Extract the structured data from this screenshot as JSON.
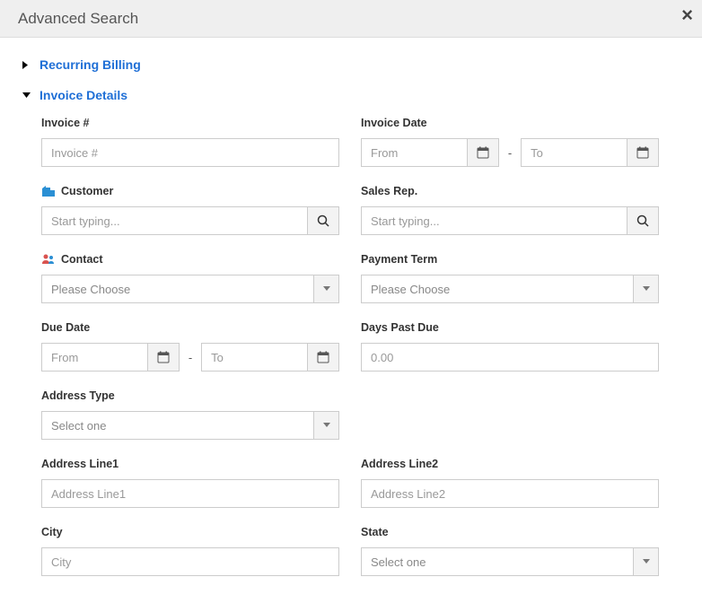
{
  "header": {
    "title": "Advanced Search"
  },
  "sections": {
    "recurring": {
      "title": "Recurring Billing"
    },
    "invoice": {
      "title": "Invoice Details"
    }
  },
  "fields": {
    "invoice_no": {
      "label": "Invoice #",
      "placeholder": "Invoice #"
    },
    "invoice_date": {
      "label": "Invoice Date",
      "from_ph": "From",
      "to_ph": "To"
    },
    "customer": {
      "label": "Customer",
      "placeholder": "Start typing..."
    },
    "sales_rep": {
      "label": "Sales Rep.",
      "placeholder": "Start typing..."
    },
    "contact": {
      "label": "Contact",
      "selected": "Please Choose"
    },
    "payment_term": {
      "label": "Payment Term",
      "selected": "Please Choose"
    },
    "due_date": {
      "label": "Due Date",
      "from_ph": "From",
      "to_ph": "To"
    },
    "days_past_due": {
      "label": "Days Past Due",
      "placeholder": "0.00"
    },
    "address_type": {
      "label": "Address Type",
      "selected": "Select one"
    },
    "address_line1": {
      "label": "Address Line1",
      "placeholder": "Address Line1"
    },
    "address_line2": {
      "label": "Address Line2",
      "placeholder": "Address Line2"
    },
    "city": {
      "label": "City",
      "placeholder": "City"
    },
    "state": {
      "label": "State",
      "selected": "Select one"
    }
  }
}
